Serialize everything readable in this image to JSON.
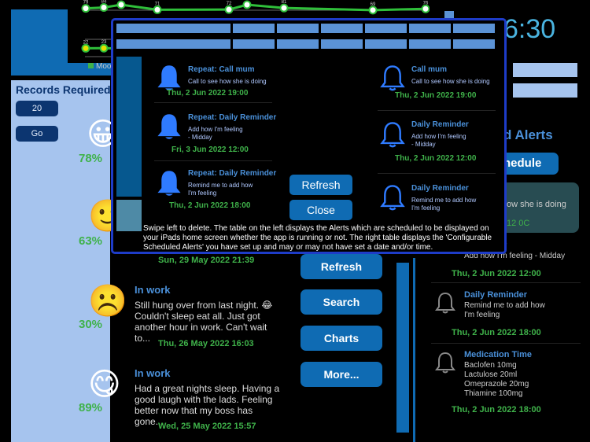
{
  "chart_data": {
    "type": "line",
    "series": [
      {
        "values": [
          79,
          84,
          100,
          71,
          72,
          100,
          81,
          69,
          76
        ]
      },
      {
        "values": [
          22,
          23,
          20,
          15
        ]
      }
    ],
    "colors": {
      "line": "#2fbf3a",
      "point_fill": "#ffffff",
      "point_low": "#e8e000"
    }
  },
  "legend": {
    "label": "Moo"
  },
  "records": {
    "title": "Records Required?",
    "input_value": "20",
    "go_label": "Go"
  },
  "entries": [
    {
      "emoji": "😀",
      "percent": "78%"
    },
    {
      "emoji": "🙂",
      "percent": "63%",
      "date": "Sun, 29 May 2022 21:39"
    },
    {
      "emoji": "☹️",
      "percent": "30%",
      "title": "In work",
      "body": "Still hung over from last night. 😂 Couldn't sleep eat all. Just got another hour in work. Can't wait to...",
      "date": "Thu, 26 May 2022 16:03"
    },
    {
      "emoji": "😋",
      "percent": "89%",
      "title": "In work",
      "body": "Had a great nights sleep. Having a good laugh with the lads. Feeling better now that my boss has gone...",
      "date": "Wed, 25 May 2022 15:57"
    }
  ],
  "actions": {
    "refresh": "Refresh",
    "search": "Search",
    "charts": "Charts",
    "more": "More..."
  },
  "right_panel": {
    "clock": "6:30",
    "header": "d Alerts",
    "schedule_button": "hedule",
    "card_text": "ow she is doing",
    "card_date": "12 0C",
    "items": [
      {
        "title": "r",
        "body": "Add how I'm feeling - Midday",
        "date": "Thu, 2 Jun 2022 12:00"
      },
      {
        "title": "Daily Reminder",
        "body": "Remind me to add how I'm feeling",
        "date": "Thu, 2 Jun 2022 18:00"
      },
      {
        "title": "Medication Time",
        "body": "Baclofen 10mg\nLactulose 20ml\nOmeprazole 20mg\nThiamine 100mg",
        "date": "Thu, 2 Jun 2022 18:00"
      }
    ]
  },
  "modal": {
    "left_items": [
      {
        "title": "Repeat: Call mum",
        "body": "Call to see how she is doing",
        "date": "Thu, 2 Jun 2022 19:00"
      },
      {
        "title": "Repeat: Daily Reminder",
        "body": "Add how I'm feeling\n- Midday",
        "date": "Fri, 3 Jun 2022 12:00"
      },
      {
        "title": "Repeat: Daily Reminder",
        "body": "Remind me to add how\nI'm feeling",
        "date": "Thu, 2 Jun 2022 18:00"
      }
    ],
    "right_items": [
      {
        "title": "Call mum",
        "body": "Call to see how she is doing",
        "date": "Thu, 2 Jun 2022 19:00"
      },
      {
        "title": "Daily Reminder",
        "body": "Add how I'm feeling\n- Midday",
        "date": "Thu, 2 Jun 2022 12:00"
      },
      {
        "title": "Daily Reminder",
        "body": "Remind me to add how\nI'm feeling",
        "date": ""
      }
    ],
    "refresh_label": "Refresh",
    "close_label": "Close",
    "info_text": "Swipe left to delete. The table on the left displays the Alerts which are scheduled to be displayed on your iPads home screen whether the app is running or not. The right table displays the 'Configurable Scheduled Alerts' you have set up and may or may not have set a date and/or time."
  }
}
